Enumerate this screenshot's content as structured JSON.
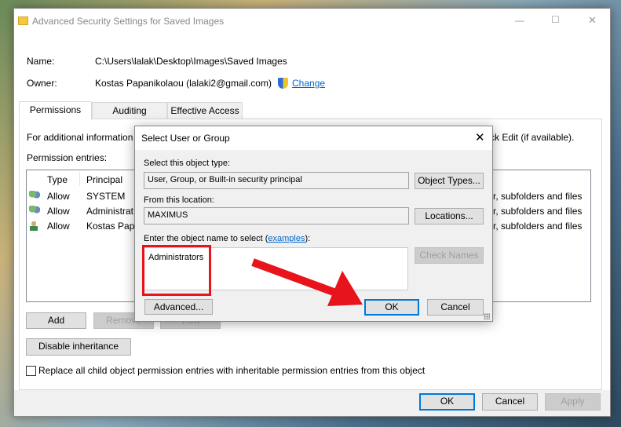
{
  "window": {
    "title": "Advanced Security Settings for Saved Images",
    "minimize": "—",
    "maximize": "☐",
    "close": "✕"
  },
  "info": {
    "name_label": "Name:",
    "name_value": "C:\\Users\\lalak\\Desktop\\Images\\Saved Images",
    "owner_label": "Owner:",
    "owner_value": "Kostas Papanikolaou (lalaki2@gmail.com)",
    "change_link": "Change"
  },
  "tabs": [
    {
      "label": "Permissions",
      "selected": true
    },
    {
      "label": "Auditing"
    },
    {
      "label": "Effective Access"
    }
  ],
  "panel": {
    "info_text_left": "For additional information",
    "info_text_right": "ck Edit (if available).",
    "entries_label": "Permission entries:"
  },
  "table": {
    "headers": [
      "Type",
      "Principal"
    ],
    "rows": [
      {
        "type": "Allow",
        "principal": "SYSTEM",
        "applies": "r, subfolders and files",
        "icon": "group-icon"
      },
      {
        "type": "Allow",
        "principal": "Administrat",
        "applies": "r, subfolders and files",
        "icon": "group-icon"
      },
      {
        "type": "Allow",
        "principal": "Kostas Papa",
        "applies": "r, subfolders and files",
        "icon": "user-icon"
      }
    ]
  },
  "buttons": {
    "add": "Add",
    "remove": "Remove",
    "view": "View",
    "disable_inheritance": "Disable inheritance",
    "ok": "OK",
    "cancel": "Cancel",
    "apply": "Apply"
  },
  "replace_checkbox": {
    "label": "Replace all child object permission entries with inheritable permission entries from this object",
    "checked": false
  },
  "dialog": {
    "title": "Select User or Group",
    "close": "✕",
    "object_type_label": "Select this object type:",
    "object_type_value": "User, Group, or Built-in security principal",
    "object_types_button": "Object Types...",
    "location_label": "From this location:",
    "location_value": "MAXIMUS",
    "locations_button": "Locations...",
    "name_label_pre": "Enter the object name to select (",
    "name_label_link": "examples",
    "name_label_post": "):",
    "name_value": "Administrators",
    "check_names_button": "Check Names",
    "advanced_button": "Advanced...",
    "ok_button": "OK",
    "cancel_button": "Cancel"
  },
  "colors": {
    "annotation": "#e8141b",
    "link": "#0066cc",
    "focus": "#0078d7"
  }
}
